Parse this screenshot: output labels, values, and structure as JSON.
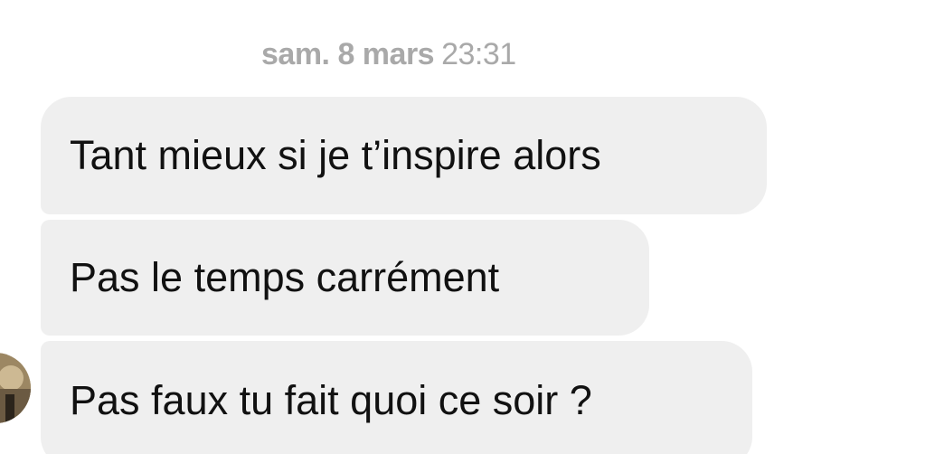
{
  "timestamp": {
    "day": "sam. 8 mars",
    "time": "23:31"
  },
  "messages": [
    {
      "text": "Tant mieux si je t’inspire alors"
    },
    {
      "text": "Pas le temps carrément"
    },
    {
      "text": "Pas faux tu fait quoi ce soir ?"
    }
  ],
  "avatar": {
    "icon": "profile-photo"
  },
  "colors": {
    "bubble_background": "#efefef",
    "message_text": "#111111",
    "timestamp_text": "#a9a9a9",
    "background": "#ffffff"
  }
}
